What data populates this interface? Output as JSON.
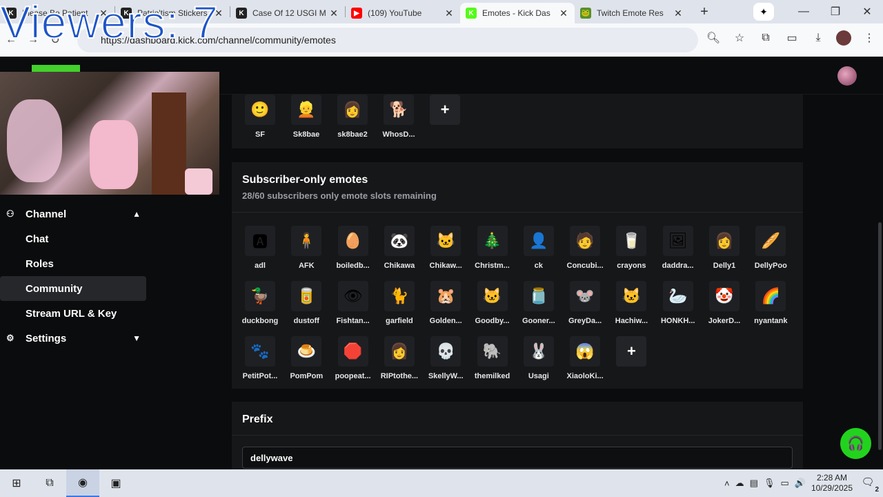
{
  "overlay": {
    "viewers": "Viewers: 7"
  },
  "browser": {
    "tabs": [
      {
        "title": "Please Be Patient",
        "fav_text": "K",
        "fav_color": "#222222",
        "active": false
      },
      {
        "title": "Patrio'tism Stickers",
        "fav_text": "K",
        "fav_color": "#222222",
        "active": false
      },
      {
        "title": "Case Of 12 USGI M",
        "fav_text": "K",
        "fav_color": "#222222",
        "active": false
      },
      {
        "title": "(109) YouTube",
        "fav_text": "▶",
        "fav_color": "#ff0000",
        "active": false
      },
      {
        "title": "Emotes - Kick Das",
        "fav_text": "K",
        "fav_color": "#53fc18",
        "active": true
      },
      {
        "title": "Twitch Emote Res",
        "fav_text": "🐸",
        "fav_color": "#5a8f2a",
        "active": false
      }
    ],
    "url": "https://dashboard.kick.com/channel/community/emotes",
    "url_visible": "http  ...  ashbo  ...  .com/channel/community/emotes"
  },
  "sidebar": {
    "channel": "Channel",
    "items": [
      "Chat",
      "Roles",
      "Community",
      "Stream URL & Key"
    ],
    "settings": "Settings"
  },
  "top_emotes": [
    {
      "label": "SF",
      "icon": "🙂"
    },
    {
      "label": "Sk8bae",
      "icon": "👱"
    },
    {
      "label": "sk8bae2",
      "icon": "👩"
    },
    {
      "label": "WhosD...",
      "icon": "🐕"
    }
  ],
  "subscriber": {
    "title": "Subscriber-only emotes",
    "subtitle": "28/60 subscribers only emote slots remaining",
    "emotes": [
      {
        "label": "adl",
        "icon": "🅰"
      },
      {
        "label": "AFK",
        "icon": "🧍"
      },
      {
        "label": "boiledb...",
        "icon": "🥚"
      },
      {
        "label": "Chikawa",
        "icon": "🐼"
      },
      {
        "label": "Chikaw...",
        "icon": "🐱"
      },
      {
        "label": "Christm...",
        "icon": "🎄"
      },
      {
        "label": "ck",
        "icon": "👤"
      },
      {
        "label": "Concubi...",
        "icon": "🧑"
      },
      {
        "label": "crayons",
        "icon": "🥛"
      },
      {
        "label": "daddra...",
        "icon": "🖼"
      },
      {
        "label": "Delly1",
        "icon": "👩"
      },
      {
        "label": "DellyPoo",
        "icon": "🥖"
      },
      {
        "label": "duckbong",
        "icon": "🦆"
      },
      {
        "label": "dustoff",
        "icon": "🥫"
      },
      {
        "label": "Fishtan...",
        "icon": "👁"
      },
      {
        "label": "garfield",
        "icon": "🐈"
      },
      {
        "label": "Golden...",
        "icon": "🐹"
      },
      {
        "label": "Goodby...",
        "icon": "🐱"
      },
      {
        "label": "Gooner...",
        "icon": "🫙"
      },
      {
        "label": "GreyDa...",
        "icon": "🐭"
      },
      {
        "label": "Hachiw...",
        "icon": "🐱"
      },
      {
        "label": "HONKH...",
        "icon": "🦢"
      },
      {
        "label": "JokerD...",
        "icon": "🤡"
      },
      {
        "label": "nyantank",
        "icon": "🌈"
      },
      {
        "label": "PetitPot...",
        "icon": "🐾"
      },
      {
        "label": "PomPom",
        "icon": "🍮"
      },
      {
        "label": "poopeat...",
        "icon": "🛑"
      },
      {
        "label": "RIPtothe...",
        "icon": "👩"
      },
      {
        "label": "SkellyW...",
        "icon": "💀"
      },
      {
        "label": "themilked",
        "icon": "🐘"
      },
      {
        "label": "Usagi",
        "icon": "🐰"
      },
      {
        "label": "XiaoloKi...",
        "icon": "😱"
      }
    ]
  },
  "prefix": {
    "title": "Prefix",
    "value": "dellywave"
  },
  "taskbar": {
    "time": "2:28 AM",
    "date": "10/29/2025",
    "notifications": "2"
  }
}
